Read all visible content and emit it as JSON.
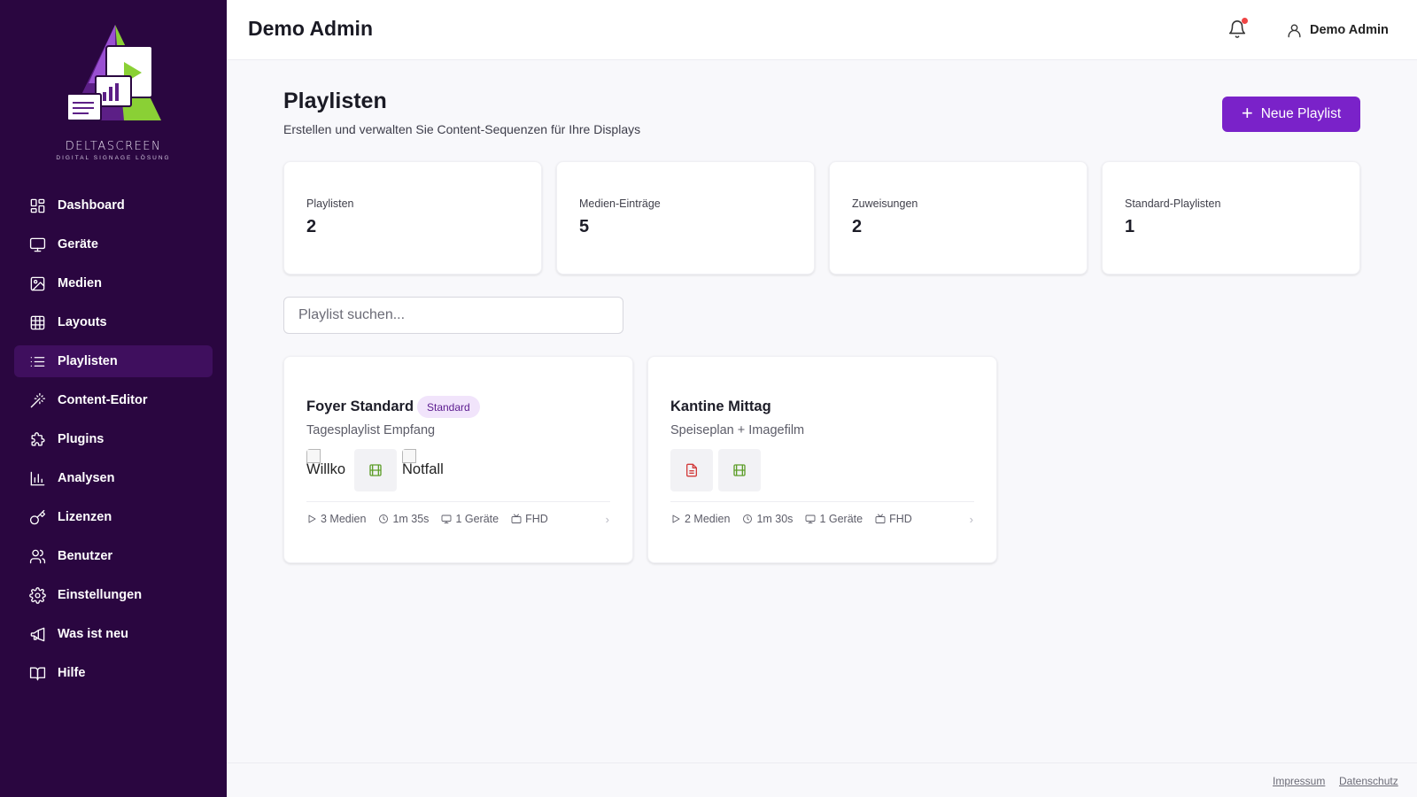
{
  "brand": {
    "name": "DELTASCREEN",
    "tagline": "DIGITAL SIGNAGE LÖSUNG"
  },
  "sidebar": {
    "items": [
      {
        "label": "Dashboard",
        "icon": "dashboard-icon",
        "active": false
      },
      {
        "label": "Geräte",
        "icon": "monitor-icon",
        "active": false
      },
      {
        "label": "Medien",
        "icon": "image-icon",
        "active": false
      },
      {
        "label": "Layouts",
        "icon": "grid-icon",
        "active": false
      },
      {
        "label": "Playlisten",
        "icon": "list-icon",
        "active": true
      },
      {
        "label": "Content-Editor",
        "icon": "magic-wand-icon",
        "active": false
      },
      {
        "label": "Plugins",
        "icon": "puzzle-icon",
        "active": false
      },
      {
        "label": "Analysen",
        "icon": "bar-chart-icon",
        "active": false
      },
      {
        "label": "Lizenzen",
        "icon": "key-icon",
        "active": false
      },
      {
        "label": "Benutzer",
        "icon": "users-icon",
        "active": false
      },
      {
        "label": "Einstellungen",
        "icon": "gear-icon",
        "active": false
      },
      {
        "label": "Was ist neu",
        "icon": "megaphone-icon",
        "active": false
      },
      {
        "label": "Hilfe",
        "icon": "book-icon",
        "active": false
      }
    ]
  },
  "header": {
    "title": "Demo Admin",
    "user_name": "Demo Admin",
    "has_notification": true
  },
  "main": {
    "title": "Playlisten",
    "subtitle": "Erstellen und verwalten Sie Content-Sequenzen für Ihre Displays",
    "new_button_label": "Neue Playlist",
    "stats": [
      {
        "label": "Playlisten",
        "value": "2"
      },
      {
        "label": "Medien-Einträge",
        "value": "5"
      },
      {
        "label": "Zuweisungen",
        "value": "2"
      },
      {
        "label": "Standard-Playlisten",
        "value": "1"
      }
    ],
    "search_placeholder": "Playlist suchen...",
    "playlists": [
      {
        "name": "Foyer Standard",
        "badge": "Standard",
        "description": "Tagesplaylist Empfang",
        "thumbs": [
          {
            "kind": "broken-image",
            "alt": "Willko"
          },
          {
            "kind": "video",
            "icon": "film-icon"
          },
          {
            "kind": "broken-image",
            "alt": "Notfall"
          }
        ],
        "media": "3 Medien",
        "duration": "1m 35s",
        "devices": "1 Geräte",
        "resolution": "FHD"
      },
      {
        "name": "Kantine Mittag",
        "badge": "",
        "description": "Speiseplan + Imagefilm",
        "thumbs": [
          {
            "kind": "document",
            "icon": "document-icon"
          },
          {
            "kind": "video",
            "icon": "film-icon"
          }
        ],
        "media": "2 Medien",
        "duration": "1m 30s",
        "devices": "1 Geräte",
        "resolution": "FHD"
      }
    ]
  },
  "footer": {
    "impressum": "Impressum",
    "datenschutz": "Datenschutz"
  },
  "colors": {
    "sidebar_bg": "#2a0640",
    "sidebar_active": "#3f0f5e",
    "accent": "#7a22c9",
    "badge_bg": "#f1e4fb",
    "notification_dot": "#ef4444",
    "video_icon": "#5e9e2a",
    "document_icon": "#d23b3b"
  }
}
